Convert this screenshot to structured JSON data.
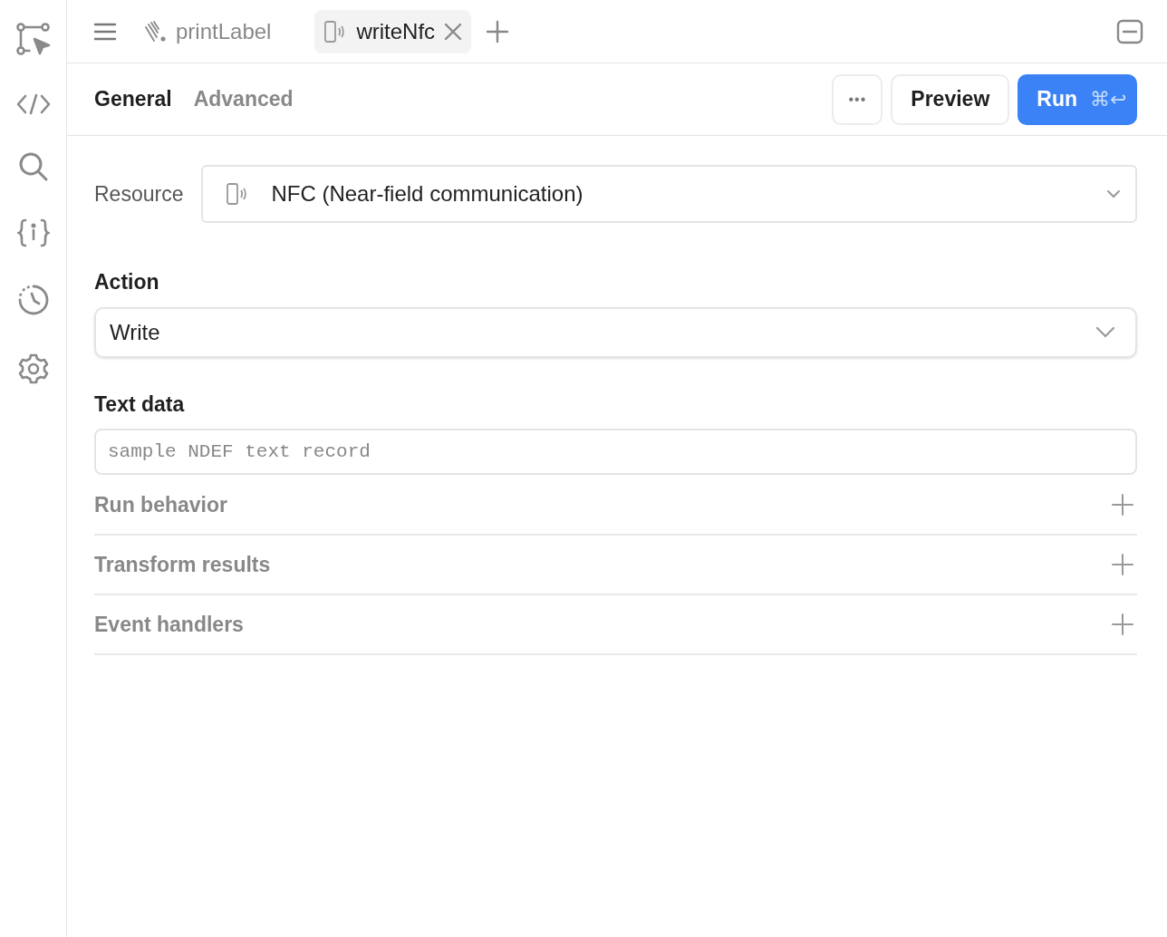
{
  "sidebar": {
    "items": [
      {
        "kind": "workflow",
        "selected": false
      },
      {
        "kind": "code",
        "selected": false
      },
      {
        "kind": "search",
        "selected": false
      },
      {
        "kind": "variables",
        "selected": false
      },
      {
        "kind": "history",
        "selected": false
      },
      {
        "kind": "settings",
        "selected": false
      }
    ]
  },
  "query_tabs": [
    {
      "label": "printLabel",
      "kind": "barcode",
      "selected": false,
      "closable": false
    },
    {
      "label": "writeNfc",
      "kind": "nfc",
      "selected": true,
      "closable": true
    }
  ],
  "editor_tabs": [
    {
      "label": "General",
      "selected": true
    },
    {
      "label": "Advanced",
      "selected": false
    }
  ],
  "actions": {
    "more": "•••",
    "preview": "Preview",
    "run": "Run",
    "shortcut": "⌘↩"
  },
  "resource": {
    "label": "Resource",
    "value": "NFC (Near-field communication)"
  },
  "action": {
    "label": "Action",
    "value": "Write"
  },
  "text_data": {
    "label": "Text data",
    "placeholder": "sample NDEF text record"
  },
  "sections": [
    {
      "label": "Run behavior",
      "expanded": false
    },
    {
      "label": "Transform results",
      "expanded": false
    },
    {
      "label": "Event handlers",
      "expanded": false
    }
  ]
}
